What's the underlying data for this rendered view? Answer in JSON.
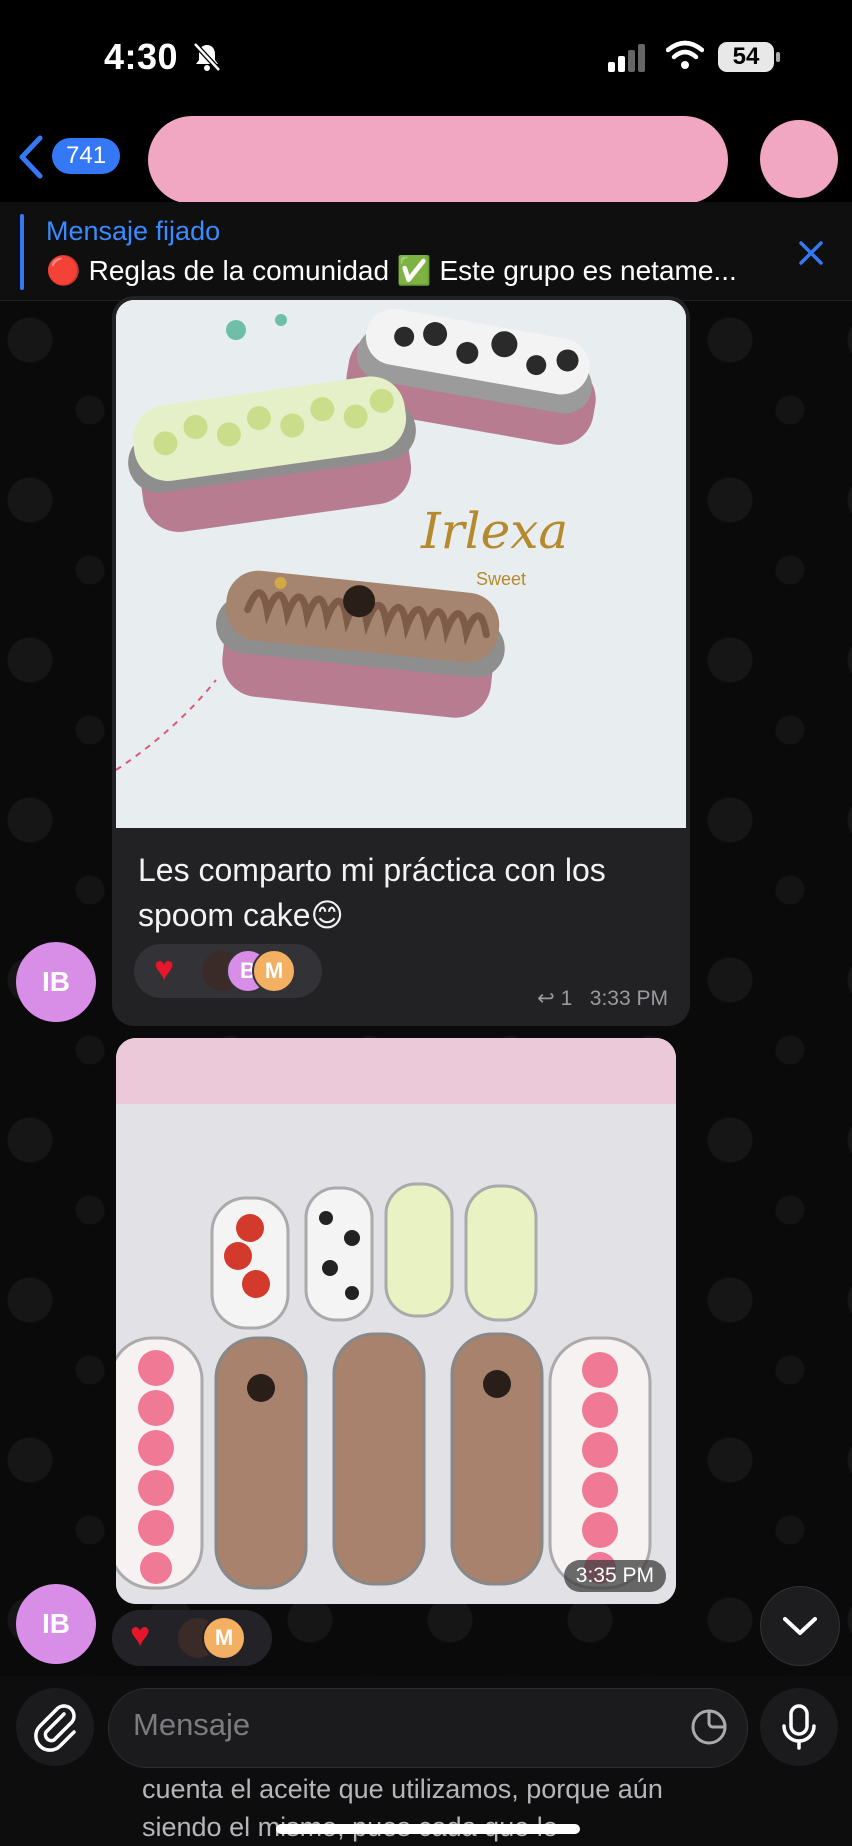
{
  "status_bar": {
    "time": "4:30",
    "battery": "54"
  },
  "header": {
    "unread_count": "741"
  },
  "pinned": {
    "title": "Mensaje fijado",
    "text": "🔴 Reglas de la comunidad ✅ Este grupo es netame..."
  },
  "message1": {
    "brand_name": "Irlexa",
    "brand_sub": "Sweet",
    "caption": "Les comparto mi práctica con los spoom cake😊",
    "reaction_avatar_1": "B",
    "reaction_avatar_2": "M",
    "reply_count": "1",
    "time": "3:33 PM",
    "sender_initials": "IB"
  },
  "message2": {
    "time": "3:35 PM",
    "reaction_avatar": "M",
    "sender_initials": "IB"
  },
  "composer": {
    "placeholder": "Mensaje",
    "background_text": "cuenta el aceite que utilizamos, porque aún siendo el mismo, pues cada que lo"
  },
  "colors": {
    "accent": "#3478f6",
    "heart": "#e8162c",
    "avatar": "#d88de6"
  }
}
